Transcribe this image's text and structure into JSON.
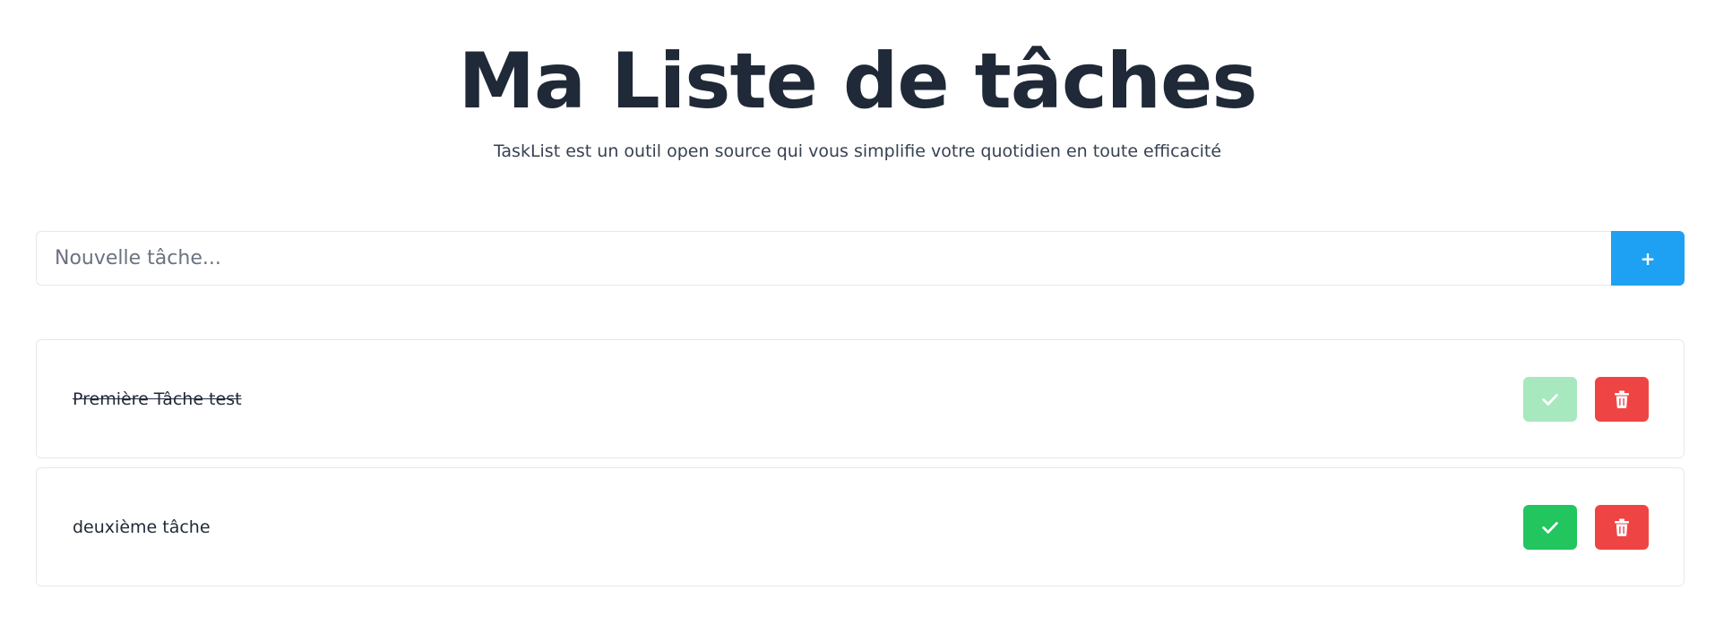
{
  "header": {
    "title": "Ma Liste de tâches",
    "subtitle": "TaskList est un outil open source qui vous simplifie votre quotidien en toute efficacité"
  },
  "form": {
    "placeholder": "Nouvelle tâche...",
    "value": "",
    "add_label": "+"
  },
  "tasks": [
    {
      "text": "Première Tâche test",
      "completed": true,
      "done_icon": "check-icon",
      "delete_icon": "trash-icon"
    },
    {
      "text": "deuxième tâche",
      "completed": false,
      "done_icon": "check-icon",
      "delete_icon": "trash-icon"
    }
  ],
  "colors": {
    "accent": "#1ea1f2",
    "done": "#22c55e",
    "done_completed": "#a7e8bf",
    "delete": "#ef4444",
    "text": "#1f2937"
  }
}
